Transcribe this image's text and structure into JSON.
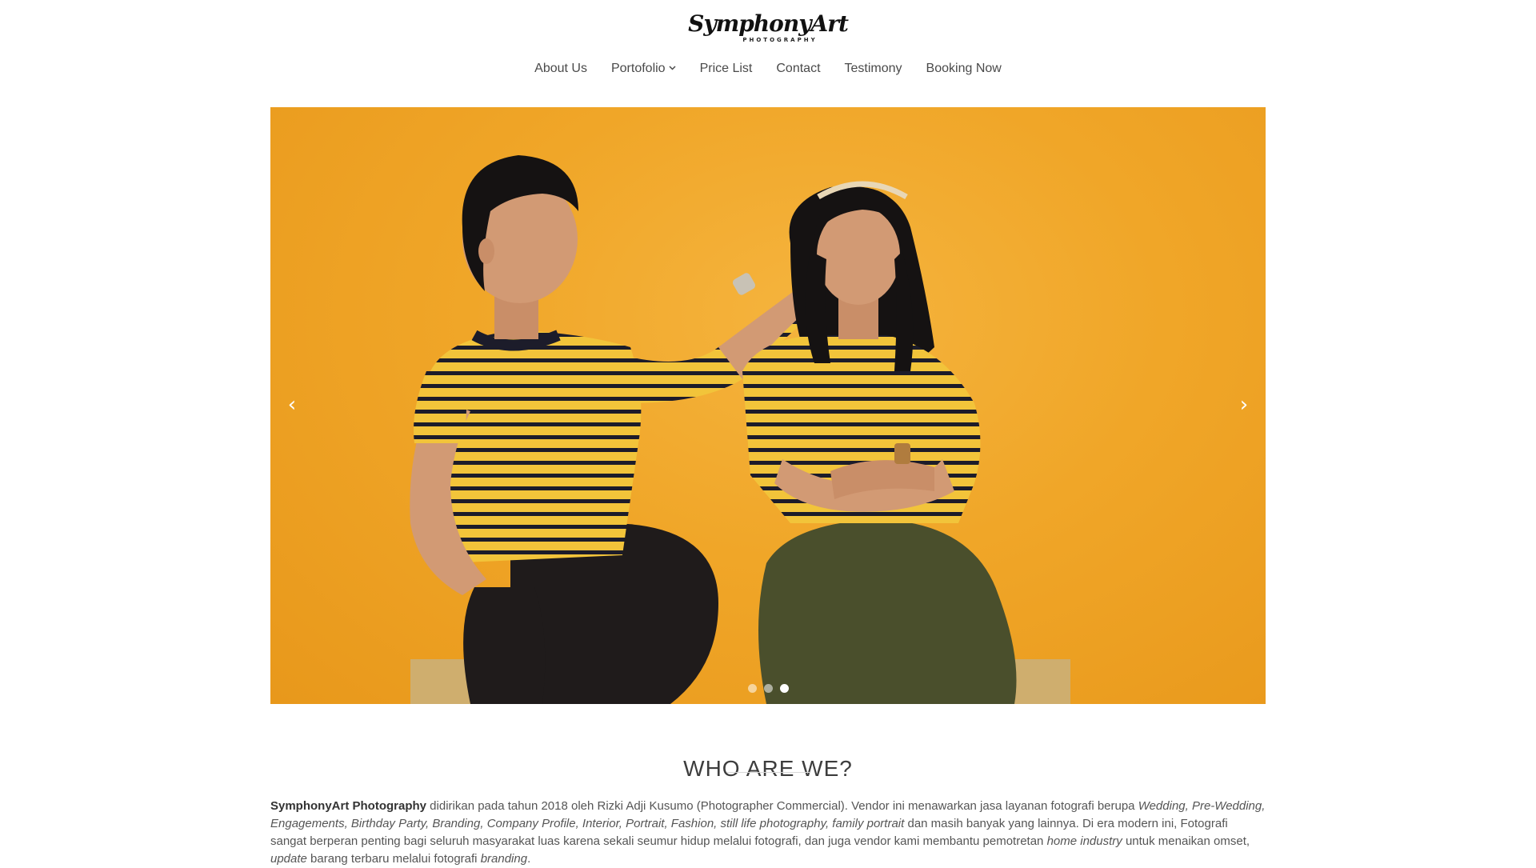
{
  "brand": {
    "logo_script": "SymphonyArt",
    "logo_sub": "PHOTOGRAPHY"
  },
  "nav": {
    "items": [
      {
        "label": "About Us"
      },
      {
        "label": "Portofolio",
        "icon": "chevron-down-icon"
      },
      {
        "label": "Price List"
      },
      {
        "label": "Contact"
      },
      {
        "label": "Testimony"
      },
      {
        "label": "Booking Now"
      }
    ]
  },
  "hero": {
    "prev_icon": "‹",
    "next_icon": "›",
    "slide_count": 3,
    "active_slide": 3,
    "colors": {
      "background": "#f0a628",
      "shirt": "#f2c43a",
      "stripe": "#1c1c2a",
      "skirt": "#4a4f2c",
      "pants": "#1f1b1b"
    }
  },
  "about": {
    "title": "WHO ARE WE?",
    "brand_name": "SymphonyArt Photography",
    "t1": " didirikan pada tahun 2018 oleh Rizki Adji Kusumo (Photographer Commercial). Vendor ini menawarkan jasa layanan fotografi berupa ",
    "i1": "Wedding, Pre-Wedding, Engagements, Birthday Party, Branding, Company Profile, Interior, Portrait, Fashion, still life photography, family portrait",
    "t2": " dan masih banyak yang lainnya. Di era modern ini, Fotografi sangat berperan penting bagi seluruh masyarakat luas karena sekali seumur hidup melalui fotografi, dan juga vendor kami membantu pemotretan ",
    "i2": "home industry",
    "t3": " untuk menaikan omset, ",
    "i3": "update",
    "t4": " barang terbaru melalui fotografi ",
    "i4": "branding",
    "t5": "."
  }
}
